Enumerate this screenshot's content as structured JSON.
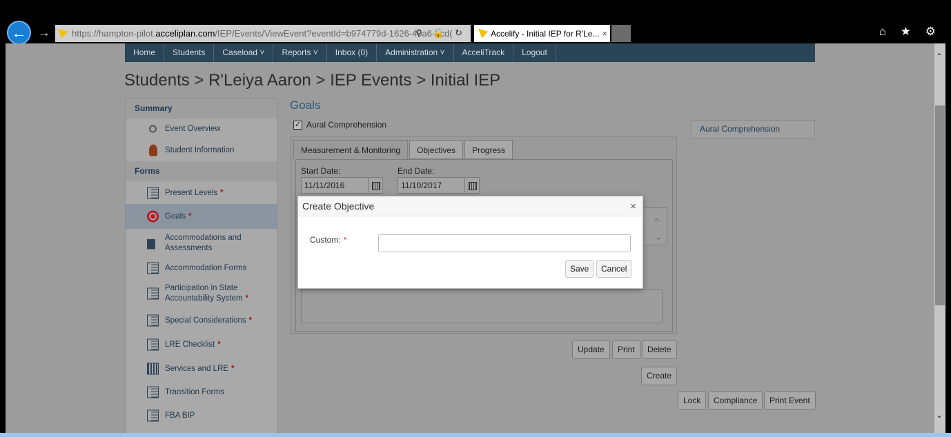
{
  "browser": {
    "url_prefix": "https://hampton-pilot.",
    "url_host": "acceliplan.com",
    "url_rest": "/IEP/Events/ViewEvent?eventId=b974779d-1626-40a6-bcd(",
    "address_icons": "⚲ 🔒 ↻",
    "tab_title": "Accelify - Initial IEP for R'Le...",
    "tab_close": "×",
    "back": "←",
    "forward": "→",
    "toolbar_icons": "⌂ ★ ⚙"
  },
  "nav": {
    "items": [
      "Home",
      "Students",
      "Caseload ˅",
      "Reports ˅",
      "Inbox (0)",
      "Administration ˅",
      "AcceliTrack",
      "Logout"
    ]
  },
  "breadcrumb": "Students > R'Leiya Aaron > IEP Events > Initial IEP",
  "sidebar": {
    "summary_heading": "Summary",
    "forms_heading": "Forms",
    "summary_items": [
      {
        "label": "Event Overview",
        "icon": "search-icon"
      },
      {
        "label": "Student Information",
        "icon": "user-icon"
      }
    ],
    "form_items": [
      {
        "label": "Present Levels",
        "req": "*"
      },
      {
        "label": "Goals",
        "req": "*"
      },
      {
        "label": "Accommodations and",
        "label2": "Assessments",
        "req": ""
      },
      {
        "label": "Accommodation Forms",
        "req": ""
      },
      {
        "label": "Participation in State",
        "label2": "Accountability System",
        "req": "*"
      },
      {
        "label": "Special Considerations",
        "req": "*"
      },
      {
        "label": "LRE Checklist",
        "req": "*"
      },
      {
        "label": "Services and LRE",
        "req": "*"
      },
      {
        "label": "Transition Forms",
        "req": ""
      },
      {
        "label": "FBA BIP",
        "req": ""
      }
    ]
  },
  "main": {
    "title": "Goals",
    "goal_checkbox_label": "Aural Comprehension",
    "goal_checkbox_mark": "✓",
    "right_box": "Aural Comprehension",
    "tabs": [
      "Measurement & Monitoring",
      "Objectives",
      "Progress"
    ],
    "start_label": "Start Date:",
    "start_value": "11/11/2016",
    "end_label": "End Date:",
    "end_value": "11/10/2017",
    "scroll_arrows": "︿\n﹀",
    "buttons": {
      "update": "Update",
      "print": "Print",
      "delete": "Delete",
      "create": "Create",
      "lock": "Lock",
      "compliance": "Compliance",
      "print_event": "Print Event"
    }
  },
  "modal": {
    "title": "Create Objective",
    "close": "×",
    "custom_label": "Custom:",
    "req": "*",
    "custom_value": "",
    "save": "Save",
    "cancel": "Cancel"
  },
  "scroll": {
    "up": "︿",
    "down": "﹀"
  }
}
